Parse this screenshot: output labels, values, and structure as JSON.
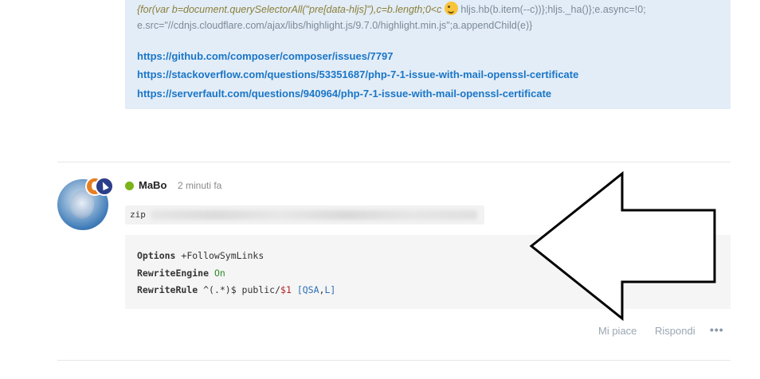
{
  "top_post": {
    "code_line_1_italic": "{for(var b=document.querySelectorAll(\"pre[data-hljs]\"),c=b.length;0<c",
    "code_line_1_rest": "hljs.hb(b.item(--c))};hljs._ha()};e.async=!0;",
    "code_line_2": "e.src=\"//cdnjs.cloudflare.com/ajax/libs/highlight.js/9.7.0/highlight.min.js\";a.appendChild(e)}",
    "links": [
      "https://github.com/composer/composer/issues/7797",
      "https://stackoverflow.com/questions/53351687/php-7-1-issue-with-mail-openssl-certificate",
      "https://serverfault.com/questions/940964/php-7-1-issue-with-mail-openssl-certificate"
    ]
  },
  "reply_post": {
    "username": "MaBo",
    "timestamp": "2 minuti fa",
    "inline_code": "zip",
    "code_lines": {
      "line1_kw": "Options",
      "line1_rest": " +FollowSymLinks",
      "line2_kw": "RewriteEngine",
      "line2_val": "On",
      "line3_kw": "RewriteRule",
      "line3_pattern": " ^(.*)$ public/",
      "line3_var": "$1",
      "line3_flags_open": " [",
      "line3_flag1": "QSA",
      "line3_comma": ",",
      "line3_flag2": "L",
      "line3_flags_close": "]"
    },
    "actions": {
      "like": "Mi piace",
      "reply": "Rispondi",
      "more": "•••"
    }
  },
  "colors": {
    "quote_bg": "#e3edf7",
    "link": "#1a76c8",
    "online": "#7bb31a"
  }
}
